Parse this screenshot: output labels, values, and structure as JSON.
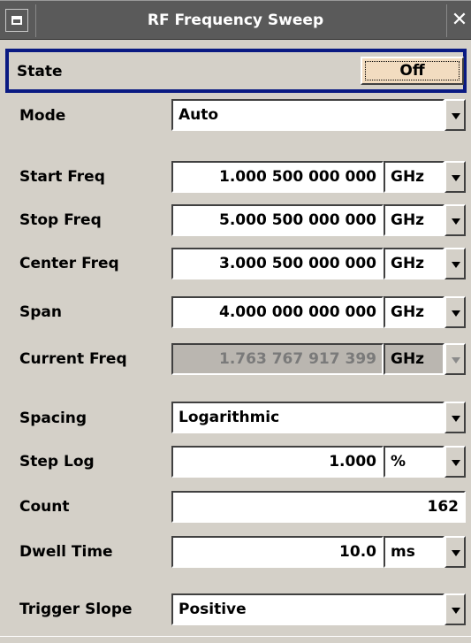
{
  "window": {
    "title": "RF Frequency Sweep",
    "close_glyph": "✕"
  },
  "state": {
    "label": "State",
    "button": "Off"
  },
  "mode": {
    "label": "Mode",
    "value": "Auto"
  },
  "start_freq": {
    "label": "Start Freq",
    "value": "1.000 500 000 000",
    "unit": "GHz"
  },
  "stop_freq": {
    "label": "Stop Freq",
    "value": "5.000 500 000 000",
    "unit": "GHz"
  },
  "center_freq": {
    "label": "Center Freq",
    "value": "3.000 500 000 000",
    "unit": "GHz"
  },
  "span": {
    "label": "Span",
    "value": "4.000 000 000 000",
    "unit": "GHz"
  },
  "current_freq": {
    "label": "Current Freq",
    "value": "1.763 767 917 399",
    "unit": "GHz"
  },
  "spacing": {
    "label": "Spacing",
    "value": "Logarithmic"
  },
  "step_log": {
    "label": "Step Log",
    "value": "1.000",
    "unit": "%"
  },
  "count": {
    "label": "Count",
    "value": "162"
  },
  "dwell_time": {
    "label": "Dwell Time",
    "value": "10.0",
    "unit": "ms"
  },
  "trigger_slope": {
    "label": "Trigger Slope",
    "value": "Positive"
  },
  "colors": {
    "title_bar": "#5a5a5a",
    "panel_bg": "#d4d0c8",
    "focus_border": "#0a1a82",
    "state_button": "#f2dcc0"
  }
}
